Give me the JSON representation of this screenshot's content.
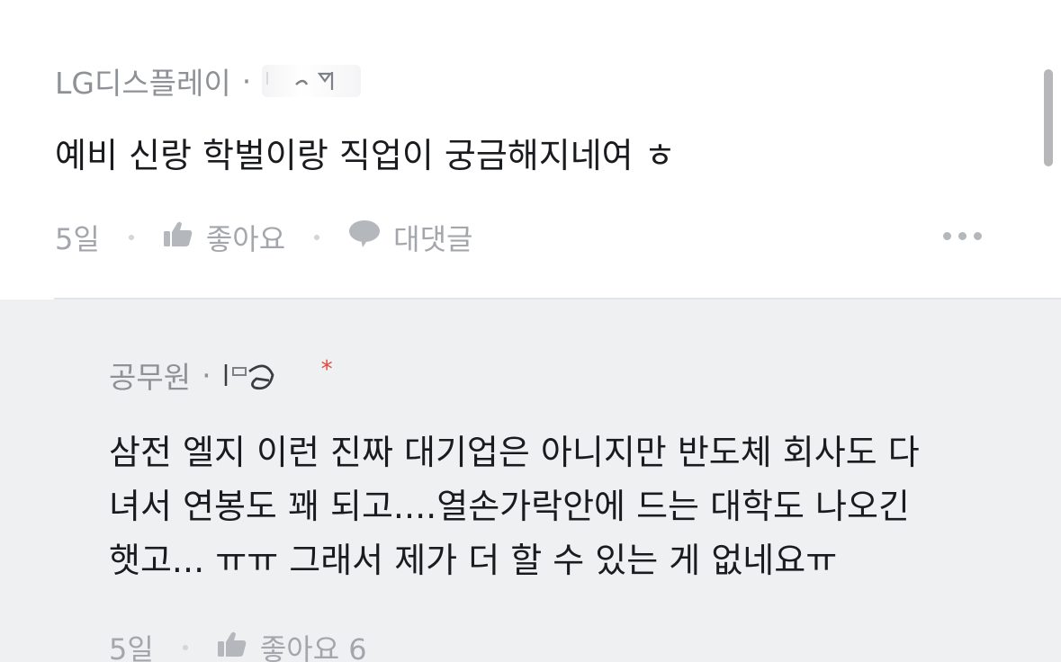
{
  "comment": {
    "author": "LG디스플레이",
    "separator": "·",
    "body": "예비 신랑 학벌이랑 직업이 궁금해지네여 ㅎ",
    "time": "5일",
    "like_label": "좋아요",
    "reply_label": "대댓글"
  },
  "reply": {
    "author": "공무원",
    "separator": "·",
    "badge": "*",
    "body_lines": [
      "삼전 엘지 이런 진짜 대기업은 아니지만 반도체 회사도 다",
      "녀서 연봉도 꽤 되고....열손가락안에 드는 대학도 나오긴",
      "햇고... ㅠㅠ 그래서 제가 더 할 수 있는 게 없네요ㅠ"
    ],
    "time": "5일",
    "like_label": "좋아요 6"
  },
  "colors": {
    "meta_text": "#8e9196",
    "body_text": "#1a1b1e",
    "reply_bg": "#eff0f2",
    "badge": "#e0473d"
  },
  "icons": {
    "like": "thumbs-up-icon",
    "reply": "speech-bubble-icon",
    "more": "more-horizontal-icon"
  }
}
